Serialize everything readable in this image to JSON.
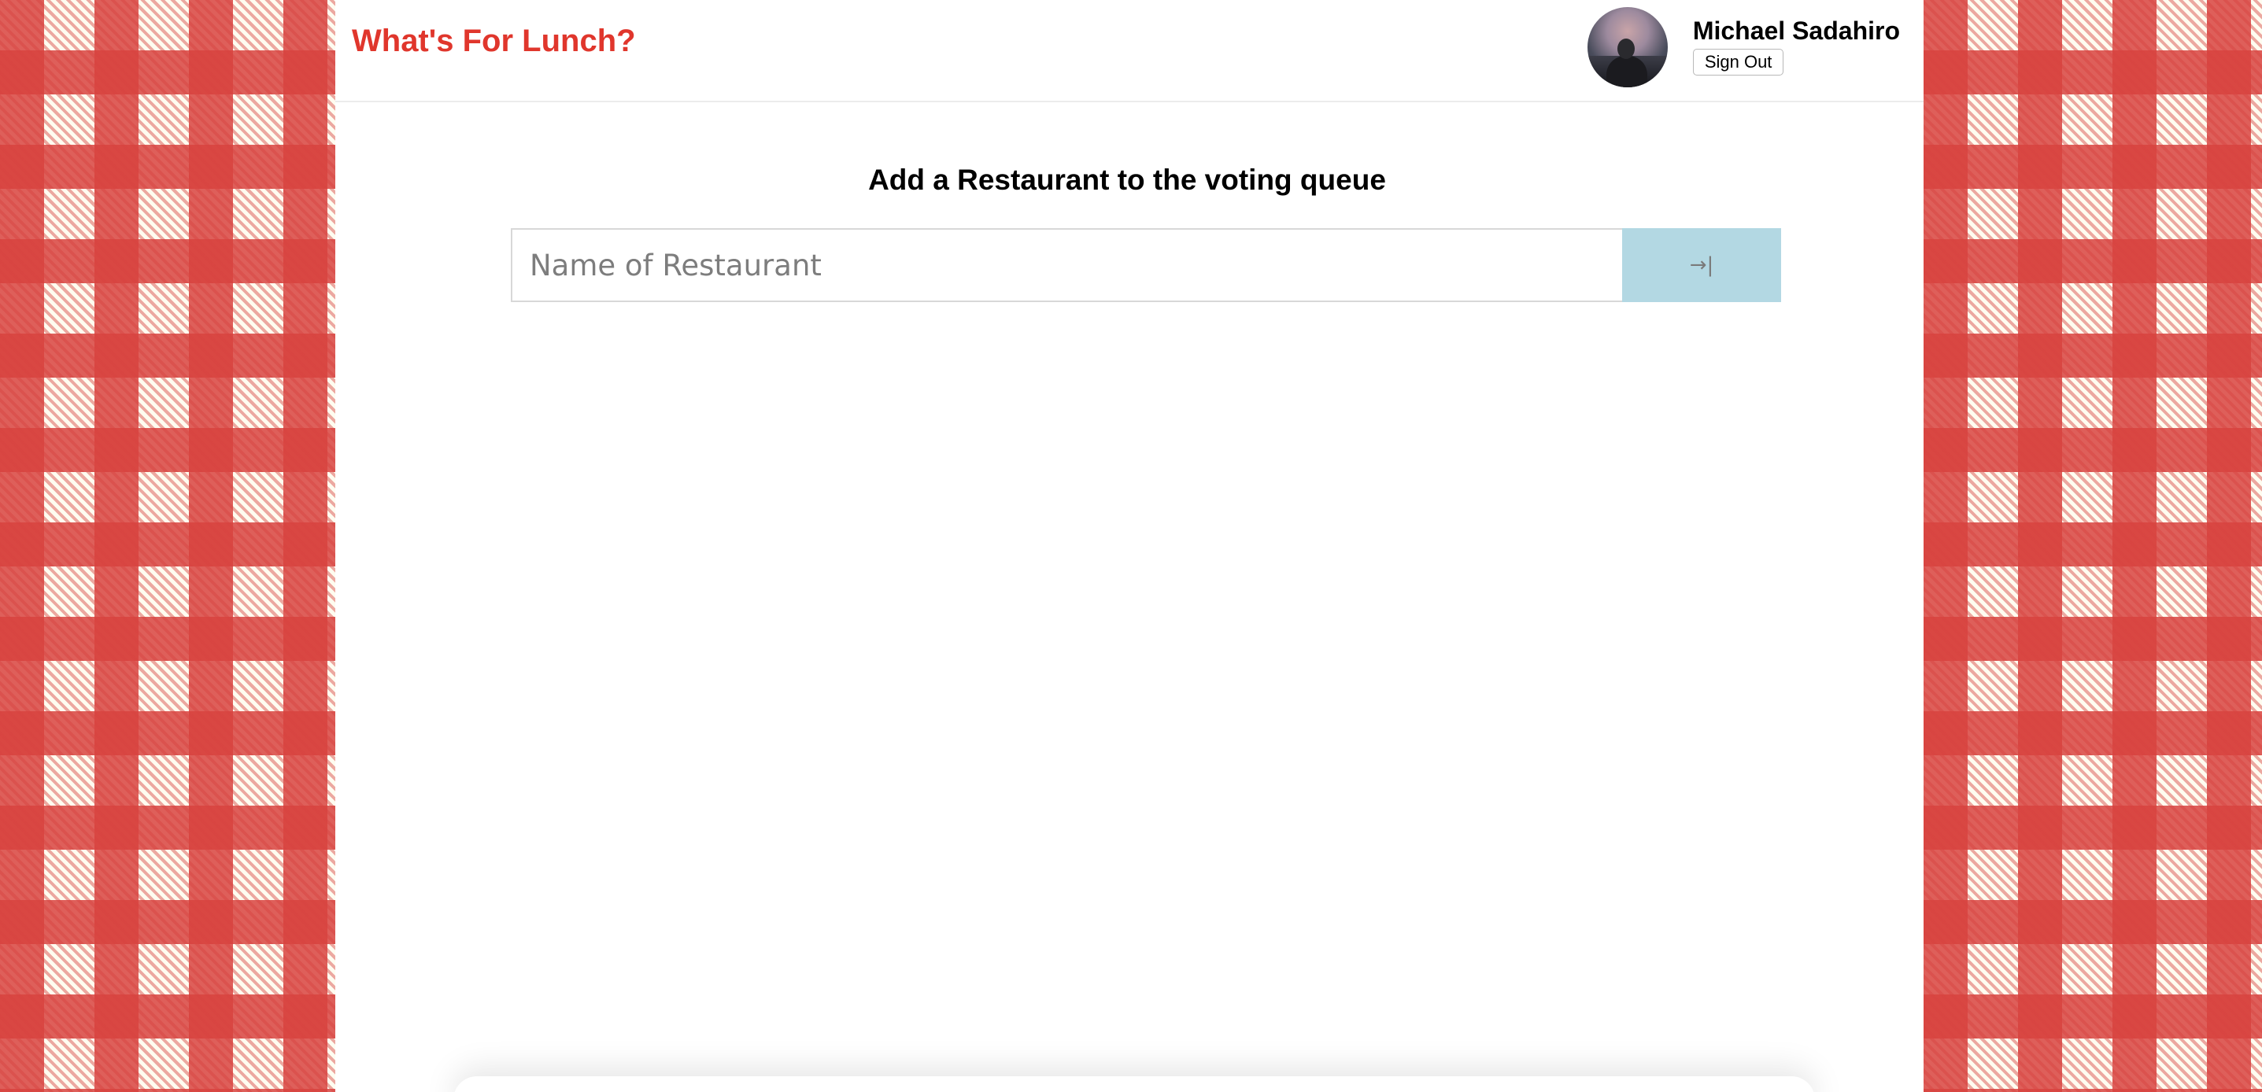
{
  "app": {
    "title": "What's For Lunch?"
  },
  "user": {
    "name": "Michael Sadahiro",
    "sign_out_label": "Sign Out"
  },
  "form": {
    "heading": "Add a Restaurant to the voting queue",
    "input_placeholder": "Name of Restaurant",
    "input_value": "",
    "submit_icon": "→|"
  },
  "colors": {
    "brand": "#e0362c",
    "tablecloth_red": "#d8433f",
    "tablecloth_cream": "#fefcf0",
    "submit_button": "#b3d8e3"
  },
  "icons": {
    "submit": "arrow-to-right-icon",
    "avatar": "user-avatar-photo"
  }
}
